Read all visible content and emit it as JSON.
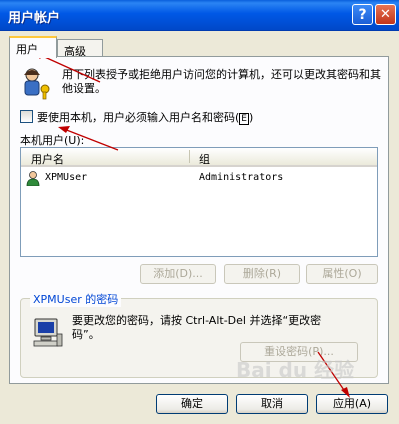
{
  "window": {
    "title": "用户帐户",
    "help_button": "?",
    "close_button": "✕"
  },
  "tabs": [
    {
      "label": "用户"
    },
    {
      "label": "高级"
    }
  ],
  "intro": {
    "text": "用下列表授予或拒绝用户访问您的计算机，还可以更改其密码和其他设置。",
    "icon": "users-key-icon"
  },
  "require_password": {
    "label_prefix": "要使用本机，用户必须输入用户名和密码",
    "accesskey": "E",
    "checked": false
  },
  "users_section": {
    "label": "本机用户(U):",
    "columns": [
      "用户名",
      "组"
    ],
    "rows": [
      {
        "name": "XPMUser",
        "group": "Administrators"
      }
    ]
  },
  "list_buttons": {
    "add": "添加(D)...",
    "remove": "删除(R)",
    "properties": "属性(O)"
  },
  "password_group": {
    "title": "XPMUser 的密码",
    "text_line1": "要更改您的密码，请按 Ctrl-Alt-Del 并选择“更改密",
    "text_line2": "码”。",
    "reset_button": "重设密码(P)...",
    "icon": "computer-icon"
  },
  "footer": {
    "ok": "确定",
    "cancel": "取消",
    "apply": "应用(A)"
  },
  "watermark": "Bai du 经验",
  "colors": {
    "titlebar": "#0058e6",
    "dialog_bg": "#ece9d8",
    "annotation": "#c00000"
  }
}
